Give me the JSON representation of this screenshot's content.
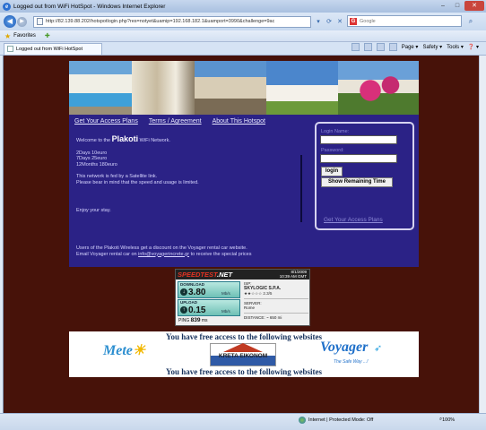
{
  "window": {
    "title": "Logged out from WiFi HotSpot - Windows Internet Explorer",
    "minimize": "–",
    "maximize": "□",
    "close": "✕"
  },
  "address_bar": {
    "url": "http://82.139.88.202/hotspotlogin.php?res=notyet&uamip=192.168.182.1&uamport=3990&challenge=9ac",
    "search_placeholder": "Google"
  },
  "favorites": {
    "label": "Favorites"
  },
  "tab": {
    "title": "Logged out from WiFi HotSpot"
  },
  "command_bar": {
    "page": "Page ▾",
    "safety": "Safety ▾",
    "tools": "Tools ▾",
    "help": "❓ ▾"
  },
  "page": {
    "nav_links": [
      "Get Your Access Plans",
      "Terms / Agreement",
      "About This Hotspot"
    ],
    "welcome_prefix": "Welcome to the ",
    "welcome_brand": "Plakoti",
    "welcome_suffix": " WiFi Network.",
    "prices": [
      "2Days 10euro",
      "7Days 25euro",
      "12Months 180euro"
    ],
    "notice_line1": "This network is fed by a Satellite link.",
    "notice_line2": "Please bear in mind that the speed and usage is limited.",
    "enjoy": "Enjoy your stay.",
    "discount_line1": "Users of the Plakoti Wireless get a discount on the Voyager rental car website.",
    "discount_line2_prefix": "Email Voyager rental car on ",
    "discount_email": "info@voyagerincrete.gr",
    "discount_line2_suffix": " to receive the special prices"
  },
  "login": {
    "login_name_label": "Login Name:",
    "password_label": "Password:",
    "login_button": "login",
    "show_remaining_button": "Show Remaining Time",
    "access_plans_link": "Get Your Access Plans"
  },
  "speedtest": {
    "logo_speed": "SPEEDTEST",
    "logo_net": ".NET",
    "date": "8/1/2009",
    "time": "10:39 AM GMT",
    "download_label": "DOWNLOAD",
    "download_value": "3.80",
    "download_unit": "Mb/s",
    "upload_label": "UPLOAD",
    "upload_value": "0.15",
    "upload_unit": "Mb/s",
    "ping_label": "PING",
    "ping_value": "839",
    "ping_unit": "ms",
    "isp_label": "ISP:",
    "isp_value": "SKYLOGIC S.P.A.",
    "isp_rating": "★★☆☆☆ 2.3/5",
    "server_label": "SERVER:",
    "server_value": "Rome",
    "distance_label": "DISTANCE:",
    "distance_value": "~ 650 mi"
  },
  "free_access": {
    "heading": "You have free access to the following websites",
    "meteo": "Mete",
    "kreta": "KRETA ΕΙΚΟΝΟΜ",
    "voyager": "Voyager",
    "voyager_tagline": "The Safe Way ...!"
  },
  "status_bar": {
    "zone": "Internet | Protected Mode: Off",
    "zoom": "100%"
  }
}
